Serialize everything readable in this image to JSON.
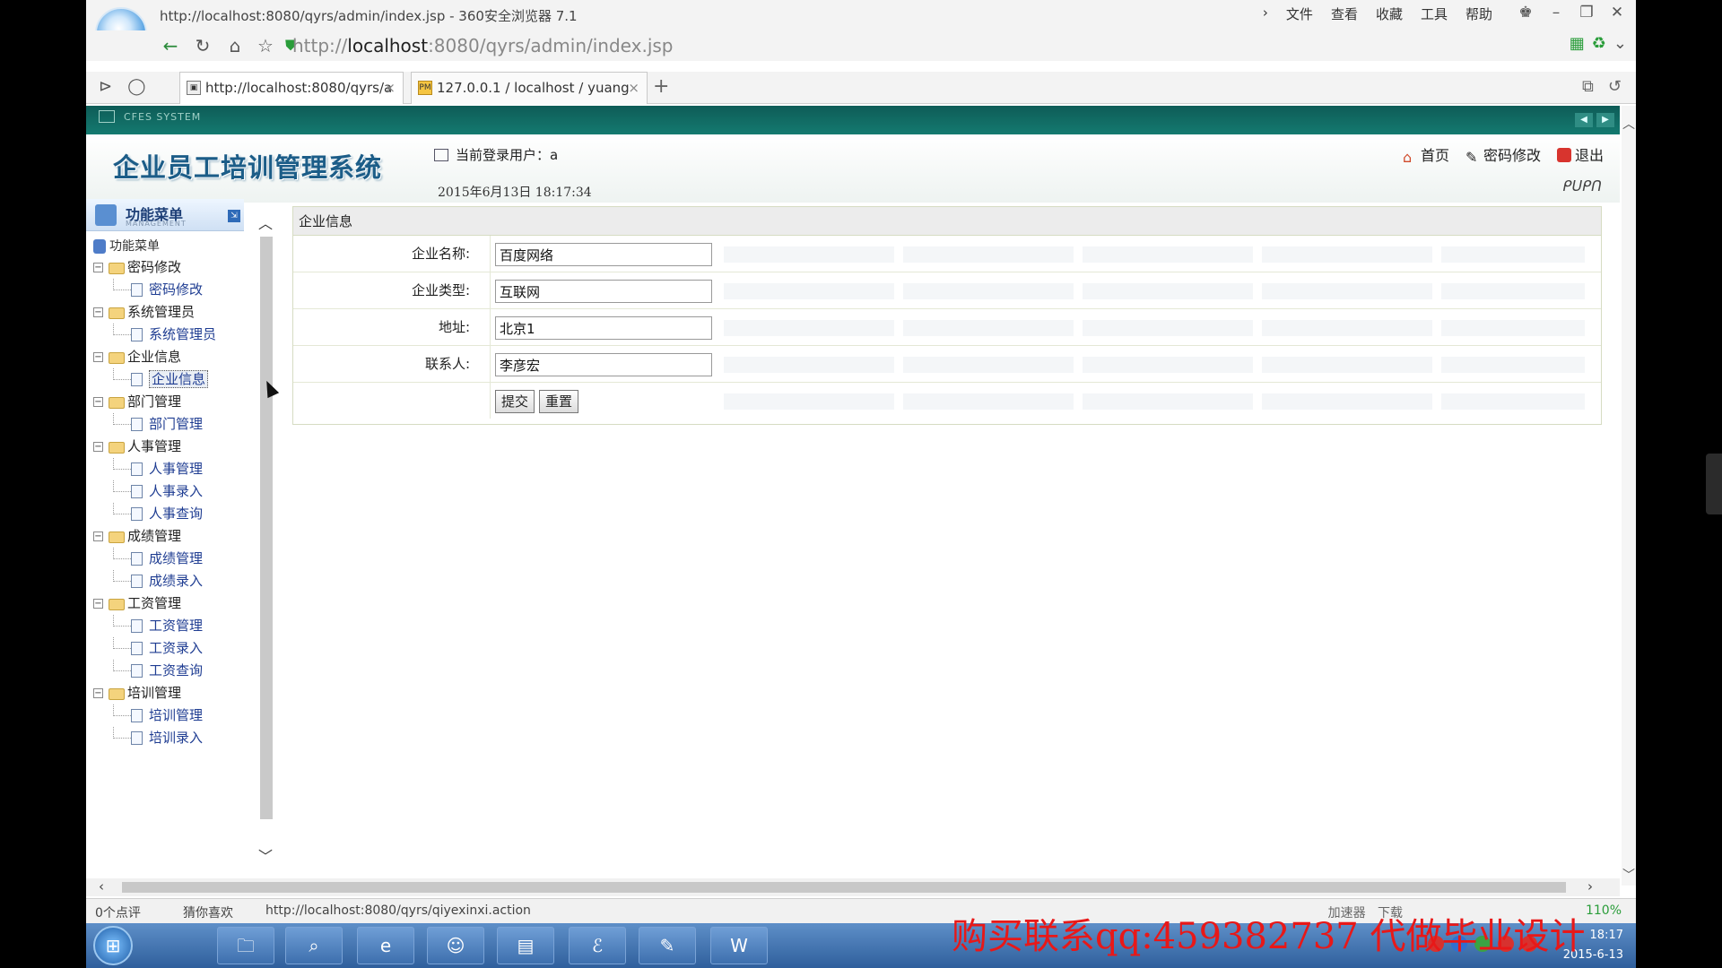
{
  "browser": {
    "window_title": "http://localhost:8080/qyrs/admin/index.jsp - 360安全浏览器 7.1",
    "menu": [
      "文件",
      "查看",
      "收藏",
      "工具",
      "帮助"
    ],
    "url_prefix": "http://",
    "url_host": "localhost",
    "url_rest": ":8080/qyrs/admin/index.jsp",
    "tabs": [
      {
        "label": "http://localhost:8080/qyrs/a",
        "active": true
      },
      {
        "label": "127.0.0.1 / localhost / yuang",
        "active": false
      }
    ],
    "status_left": "0个点评",
    "status_like": "猜你喜欢",
    "status_url": "http://localhost:8080/qyrs/qiyexinxi.action",
    "status_accel": "加速器",
    "status_download": "下载",
    "zoom": "110%"
  },
  "app": {
    "strip_label": "CFES SYSTEM",
    "title": "企业员工培训管理系统",
    "current_user_label": "当前登录用户：a",
    "datetime": "2015年6月13日 18:17:34",
    "links": {
      "home": "首页",
      "password": "密码修改",
      "logout": "退出"
    },
    "right_logo": "ᑭᑌᑭᑎ"
  },
  "sidebar": {
    "title": "功能菜单",
    "subtitle": "MANAGEMENT",
    "root": "功能菜单",
    "groups": [
      {
        "label": "密码修改",
        "items": [
          "密码修改"
        ]
      },
      {
        "label": "系统管理员",
        "items": [
          "系统管理员"
        ]
      },
      {
        "label": "企业信息",
        "items": [
          "企业信息"
        ]
      },
      {
        "label": "部门管理",
        "items": [
          "部门管理"
        ]
      },
      {
        "label": "人事管理",
        "items": [
          "人事管理",
          "人事录入",
          "人事查询"
        ]
      },
      {
        "label": "成绩管理",
        "items": [
          "成绩管理",
          "成绩录入"
        ]
      },
      {
        "label": "工资管理",
        "items": [
          "工资管理",
          "工资录入",
          "工资查询"
        ]
      },
      {
        "label": "培训管理",
        "items": [
          "培训管理",
          "培训录入"
        ]
      }
    ],
    "selected": "企业信息"
  },
  "form": {
    "title": "企业信息",
    "fields": [
      {
        "label": "企业名称:",
        "value": "百度网络"
      },
      {
        "label": "企业类型:",
        "value": "互联网"
      },
      {
        "label": "地址:",
        "value": "北京1"
      },
      {
        "label": "联系人:",
        "value": "李彦宏"
      }
    ],
    "submit": "提交",
    "reset": "重置"
  },
  "taskbar": {
    "date": "2015-6-13",
    "time": "18:17"
  },
  "watermark": "购买联系qq:459382737 代做毕业设计",
  "colors": {
    "header_strip": "#147a70",
    "title_blue": "#1c5d88",
    "link_blue": "#1f3d92",
    "watermark_red": "#e81818"
  }
}
